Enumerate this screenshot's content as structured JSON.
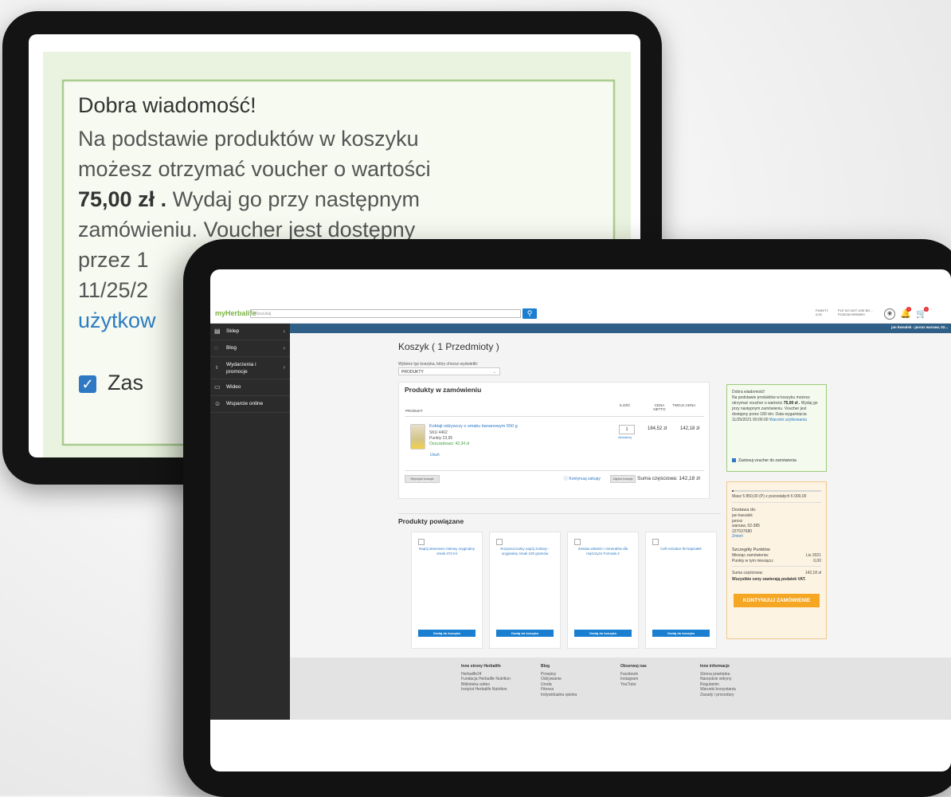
{
  "zoom": {
    "heading": "Dobra wiadomość!",
    "line1": "Na podstawie produktów w koszyku",
    "line2": "możesz otrzymać voucher o wartości",
    "amount": "75,00 zł .",
    "line3_rest": "Wydaj go przy następnym",
    "line4": "zamówieniu. Voucher jest dostępny",
    "line5": "przez 1",
    "line6": "11/25/2",
    "link": "użytkow",
    "checkbox": "Zas"
  },
  "header": {
    "logo": "myHerbalife",
    "search_placeholder": "Wyszukaj",
    "points_label": "PUNKTY",
    "points_value": "0,00",
    "level_line1": "PLE DO NOT USE BO...",
    "level_line2": "POZIOM SREBRO",
    "notifications_count": "1",
    "cart_count": "1",
    "user_bar": "jan kwoalsk - jarosz warsaw, 02..."
  },
  "sidebar": {
    "items": [
      {
        "label": "Sklep",
        "icon": "shop-icon"
      },
      {
        "label": "Blog",
        "icon": "chat-icon"
      },
      {
        "label": "Wydarzenia i",
        "label2": "promocje",
        "icon": "gift-icon"
      },
      {
        "label": "Wideo",
        "icon": "video-icon"
      },
      {
        "label": "Wsparcie online",
        "icon": "support-icon"
      }
    ]
  },
  "cart": {
    "title": "Koszyk ( 1 Przedmioty )",
    "type_label": "Wybierz typ koszyka, który chcesz wyświetlić",
    "type_value": "PRODUKTY",
    "section_title": "Produkty w zamówieniu",
    "col_product": "PRODUKT",
    "col_qty": "ILOŚĆ",
    "col_net_1": "CENA",
    "col_net_2": "NETTO",
    "col_your": "TWOJA CENA",
    "item": {
      "name": "Koktajl odżywczy o smaku bananowym 550 g",
      "sku": "SKU 4462",
      "points": "Punkty 23,95",
      "savings": "Oszczędzasz: 42,34 zł",
      "remove": "Usuń",
      "qty": "1",
      "update": "Aktualizuj",
      "net_price": "184,52 zł",
      "your_price": "142,18 zł"
    },
    "clear_cart": "Wyczyść koszyk",
    "continue_shopping": "Kontynuuj zakupy",
    "save_cart": "Zapisz koszyk",
    "subtotal": "Suma częściowa: 142,18 zł"
  },
  "voucher": {
    "heading": "Dobra wiadomość!",
    "text1": "Na podstawie produktów w koszyku możesz otrzymać voucher o wartości",
    "amount": "75,00 zł .",
    "text2": "Wydaj go przy następnym zamówieniu. Voucher jest dostępny przez 180 dni. Data wygaśnięcia 11/25/2021 00:00:00",
    "link": "Warunki użytkowania",
    "apply": "Zastosuj voucher do zamówienia"
  },
  "summary": {
    "progress_text": "Masz 5 850,00 (P) z pozostałych 6 000,00",
    "progress_fraction": 0.02,
    "delivery_label": "Dostawa do:",
    "address": [
      "jan kwoalsk",
      "jarosz",
      "warsaw, 02-385",
      "227037680"
    ],
    "change": "Zmień",
    "points_title": "Szczegóły Punktów",
    "month_label": "Miesiąc zamówienia:",
    "month_value": "Lis 2021",
    "points_label": "Punkty w tym miesiącu:",
    "points_value": "0,00",
    "subtotal_label": "Suma częściowa:",
    "subtotal_value": "142,18 zł",
    "vat_note": "Wszystkie ceny zawierają podatek VAT.",
    "checkout": "KONTYNUUJ ZAMÓWIENIE"
  },
  "related": {
    "title": "Produkty powiązane",
    "add_label": "Dodaj do koszyka",
    "items": [
      {
        "name": "Napój aloesowo-ziołowy oryginalny smak 473 ml"
      },
      {
        "name": "Rozpuszczalny napój ziołowy - oryginalny smak 100 gramów"
      },
      {
        "name": "Zestaw witamin i minerałów dla mężczyzn Formuła 2"
      },
      {
        "name": "Cell Activator 90 kapsułek"
      }
    ]
  },
  "footer": {
    "columns": [
      {
        "title": "Inne strony Herbalife",
        "links": [
          "Herbalife24",
          "Fundacja Herbalife Nutrition",
          "Biblioteka wideo",
          "Instytut Herbalife Nutrition"
        ]
      },
      {
        "title": "Blog",
        "links": [
          "Przepisy",
          "Odżywianie",
          "Uroda",
          "Fitness",
          "Indywidualna opieka"
        ]
      },
      {
        "title": "Obserwuj nas",
        "links": [
          "Facebook",
          "Instagram",
          "YouTube"
        ]
      },
      {
        "title": "Inne informacje",
        "links": [
          "Strona powitalna",
          "Narzędzie witryny",
          "Regulamin",
          "Warunki korzystania",
          "Zasady i procedury"
        ]
      }
    ]
  },
  "colors": {
    "brand_green": "#7ab342",
    "accent_blue": "#1a7fd0",
    "header_bar": "#2f5f86",
    "checkout_orange": "#f5a623"
  }
}
